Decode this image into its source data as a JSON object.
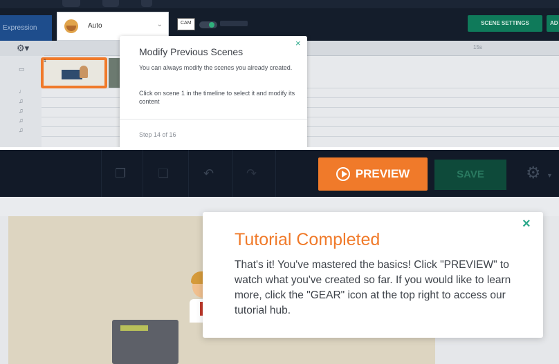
{
  "top": {
    "expression_tab": "Expression",
    "expression_select": "Auto",
    "camera_label": "CAM",
    "scene_settings": "SCENE SETTINGS",
    "ad_button": "AD",
    "ruler_mark": "15s",
    "scene_number": "1",
    "popup": {
      "title": "Modify Previous Scenes",
      "text1": "You can always modify the scenes you already created.",
      "text2": "Click on scene 1 in the timeline to select it and modify its content",
      "step": "Step 14 of 16",
      "close": "×"
    }
  },
  "bottom": {
    "preview": "PREVIEW",
    "save": "SAVE",
    "popup": {
      "title": "Tutorial Completed",
      "body": "That's it! You've mastered the basics! Click \"PREVIEW\" to watch what you've created so far. If you would like to learn more, click the \"GEAR\" icon at the top right to access our tutorial hub.",
      "close": "×"
    }
  },
  "colors": {
    "accent_orange": "#f07a2a",
    "accent_teal": "#2aa88a",
    "dark_bar": "#121a28"
  }
}
